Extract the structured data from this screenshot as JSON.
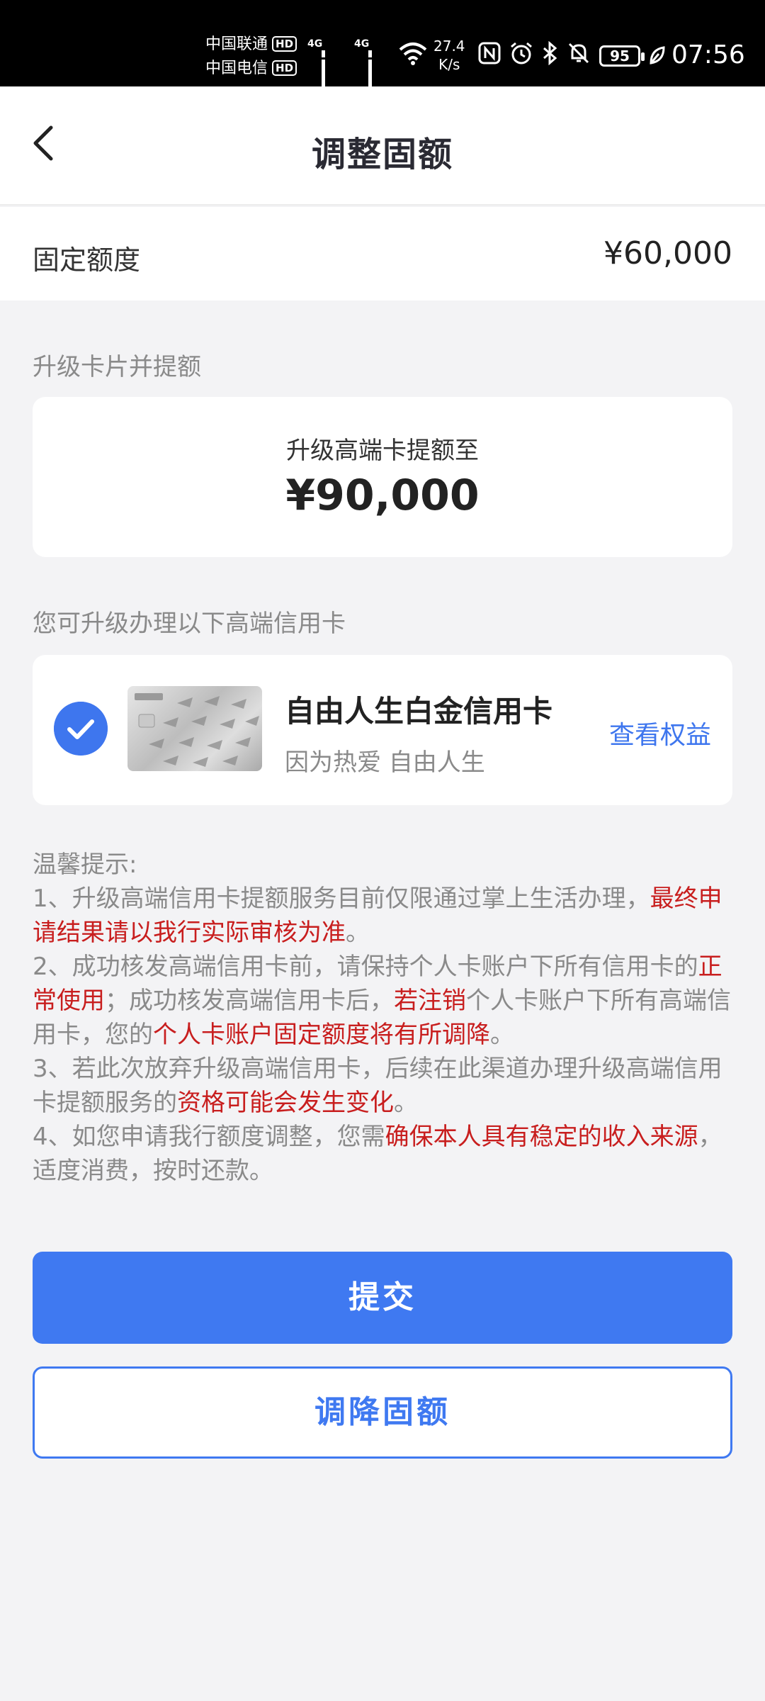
{
  "status_bar": {
    "carrier1": "中国联通",
    "carrier2": "中国电信",
    "hd_label": "HD",
    "network_type": "4G",
    "net_speed_value": "27.4",
    "net_speed_unit": "K/s",
    "battery": "95",
    "time": "07:56"
  },
  "nav": {
    "title": "调整固额"
  },
  "fixed_quota": {
    "label": "固定额度",
    "value": "¥60,000"
  },
  "upgrade_section": {
    "label": "升级卡片并提额",
    "subtitle": "升级高端卡提额至",
    "amount": "¥90,000"
  },
  "card_section": {
    "label": "您可升级办理以下高端信用卡",
    "card_name": "自由人生白金信用卡",
    "card_slogan": "因为热爱 自由人生",
    "benefits_link": "查看权益",
    "selected": true
  },
  "tips": {
    "title": "温馨提示:",
    "t1_a": "1、升级高端信用卡提额服务目前仅限通过掌上生活办理，",
    "t1_red": "最终申请结果请以我行实际审核为准",
    "t1_b": "。",
    "t2_a": "2、成功核发高端信用卡前，请保持个人卡账户下所有信用卡的",
    "t2_red1": "正常使用",
    "t2_b": "；成功核发高端信用卡后，",
    "t2_red2": "若注销",
    "t2_c": "个人卡账户下所有高端信用卡，您的",
    "t2_red3": "个人卡账户固定额度将有所调降",
    "t2_d": "。",
    "t3_a": "3、若此次放弃升级高端信用卡，后续在此渠道办理升级高端信用卡提额服务的",
    "t3_red": "资格可能会发生变化",
    "t3_b": "。",
    "t4_a": "4、如您申请我行额度调整，您需",
    "t4_red": "确保本人具有稳定的收入来源",
    "t4_b": "，适度消费，按时还款。"
  },
  "buttons": {
    "submit": "提交",
    "reduce": "调降固额"
  },
  "colors": {
    "accent": "#3f79f1",
    "warning_red": "#c81e1e"
  }
}
